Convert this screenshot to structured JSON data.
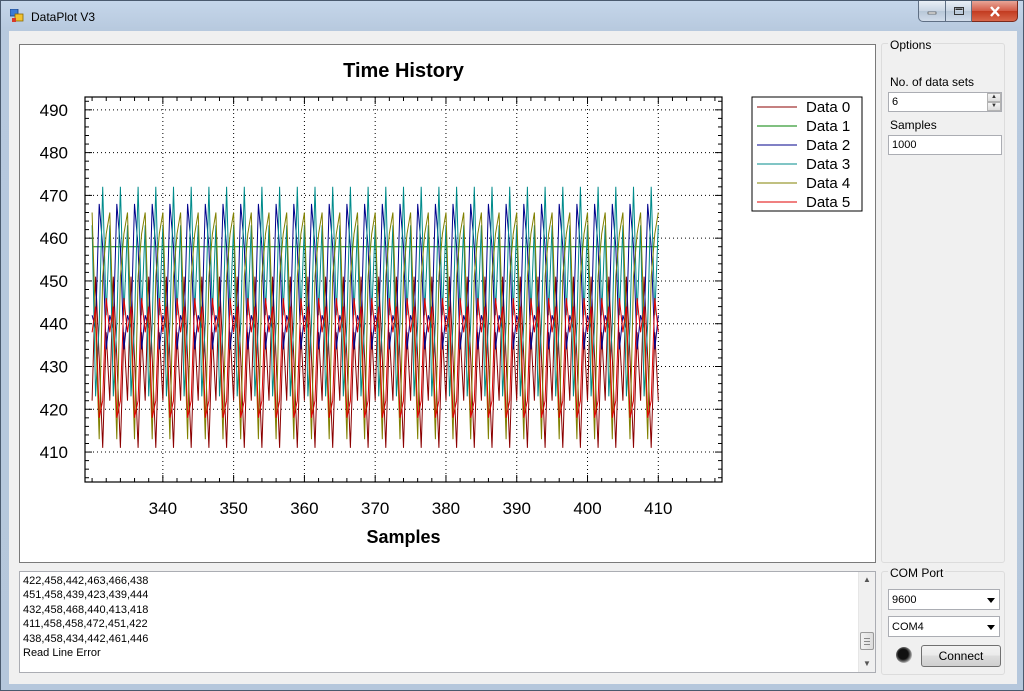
{
  "window": {
    "title": "DataPlot V3"
  },
  "chart_data": {
    "type": "line",
    "title": "Time History",
    "xlabel": "Samples",
    "ylabel": "",
    "xlim": [
      329,
      419
    ],
    "ylim": [
      403,
      493
    ],
    "xticks": [
      340,
      350,
      360,
      370,
      380,
      390,
      400,
      410
    ],
    "yticks": [
      410,
      420,
      430,
      440,
      450,
      460,
      470,
      480,
      490
    ],
    "grid": true,
    "legend_position": "top-right",
    "series": [
      {
        "name": "Data 0",
        "color": "#8b0000",
        "period": 4,
        "values": [
          422,
          451,
          432,
          411,
          438
        ]
      },
      {
        "name": "Data 1",
        "color": "#008000",
        "values": [
          458
        ]
      },
      {
        "name": "Data 2",
        "color": "#00008b",
        "period": 5,
        "values": [
          442,
          439,
          468,
          458,
          434
        ]
      },
      {
        "name": "Data 3",
        "color": "#008b8b",
        "period": 5,
        "values": [
          463,
          423,
          440,
          472,
          442
        ]
      },
      {
        "name": "Data 4",
        "color": "#808000",
        "period": 4,
        "values": [
          466,
          439,
          413,
          451,
          461
        ]
      },
      {
        "name": "Data 5",
        "color": "#e00000",
        "period": 4,
        "values": [
          438,
          444,
          418,
          422,
          446
        ]
      }
    ]
  },
  "options": {
    "group_label": "Options",
    "datasets_label": "No. of data sets",
    "datasets_value": "6",
    "samples_label": "Samples",
    "samples_value": "1000"
  },
  "log": {
    "lines": [
      "422,458,442,463,466,438",
      "451,458,439,423,439,444",
      "432,458,468,440,413,418",
      "411,458,458,472,451,422",
      "438,458,434,442,461,446",
      "Read Line Error"
    ]
  },
  "com": {
    "group_label": "COM Port",
    "baud": "9600",
    "port": "COM4",
    "connect_label": "Connect"
  }
}
